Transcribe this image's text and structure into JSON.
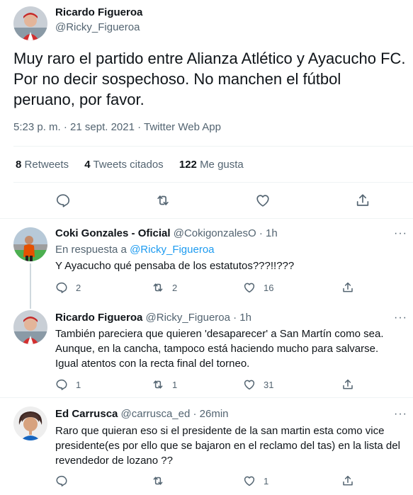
{
  "main_tweet": {
    "author_name": "Ricardo Figueroa",
    "author_handle": "@Ricky_Figueroa",
    "text": "Muy raro el partido entre Alianza Atlético y Ayacucho FC. Por no decir sospechoso. No manchen el fútbol peruano, por favor.",
    "timestamp": "5:23 p. m. · 21 sept. 2021 · Twitter Web App",
    "stats": {
      "retweets_count": "8",
      "retweets_label": "Retweets",
      "quotes_count": "4",
      "quotes_label": "Tweets citados",
      "likes_count": "122",
      "likes_label": "Me gusta"
    }
  },
  "replies": [
    {
      "name": "Coki Gonzales - Oficial",
      "handle_time": "@CokigonzalesO · 1h",
      "replying_prefix": "En respuesta a",
      "replying_to": "@Ricky_Figueroa",
      "text": "Y Ayacucho qué pensaba de los estatutos???!!???",
      "reply_count": "2",
      "retweet_count": "2",
      "like_count": "16"
    },
    {
      "name": "Ricardo Figueroa",
      "handle_time": "@Ricky_Figueroa · 1h",
      "text": "También pareciera que quieren 'desaparecer' a San Martín como sea. Aunque, en la cancha, tampoco está haciendo mucho para salvarse. Igual atentos con la recta final del torneo.",
      "reply_count": "1",
      "retweet_count": "1",
      "like_count": "31"
    },
    {
      "name": "Ed Carrusca",
      "handle_time": "@carrusca_ed · 26min",
      "text": "Raro que quieran eso si el presidente de la san martin esta como vice presidente(es por ello que se bajaron en el reclamo del tas) en la lista del revendedor de lozano ??",
      "reply_count": "",
      "retweet_count": "",
      "like_count": "1"
    }
  ],
  "more_glyph": "···",
  "icons": [
    "reply-icon",
    "retweet-icon",
    "like-icon",
    "share-icon",
    "more-icon"
  ],
  "colors": {
    "link": "#1d9bf0",
    "secondary_text": "#536471",
    "thread_line": "#cfd9de"
  }
}
